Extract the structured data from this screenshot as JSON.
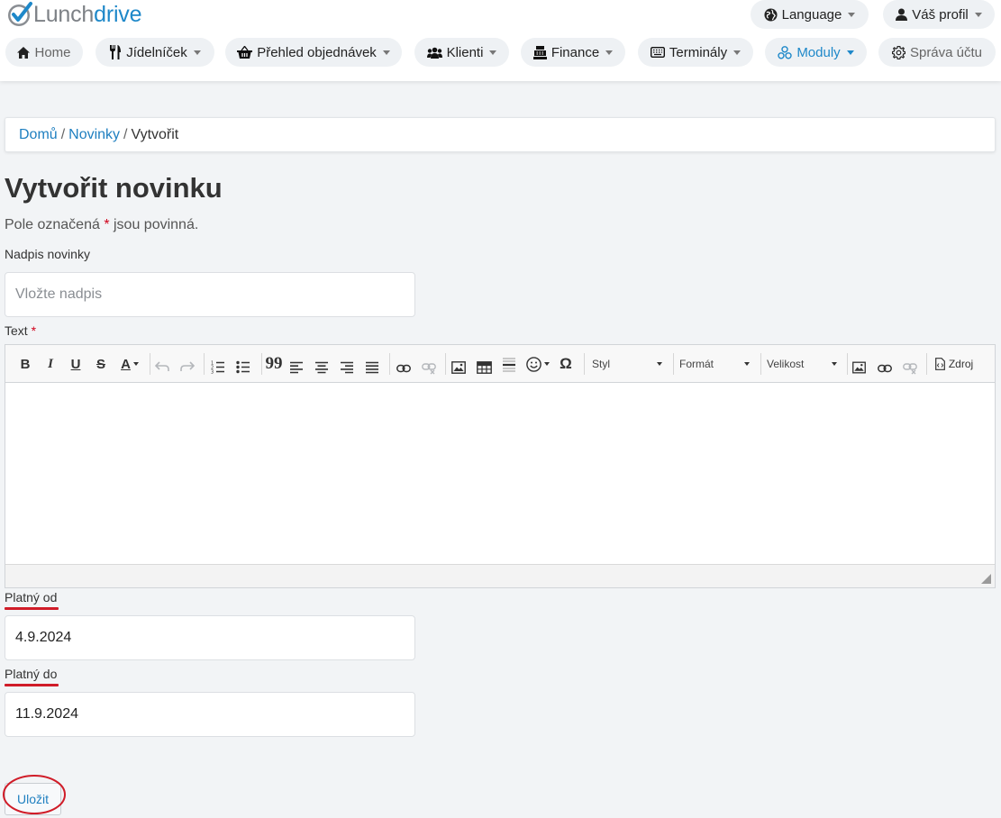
{
  "logo": {
    "part1": "Lunch",
    "part2": "drive"
  },
  "topnav": {
    "language": "Language",
    "profile": "Váš profil",
    "items": [
      {
        "label": "Home",
        "icon": "home-icon"
      },
      {
        "label": "Jídelníček",
        "icon": "cutlery-icon"
      },
      {
        "label": "Přehled objednávek",
        "icon": "basket-icon"
      },
      {
        "label": "Klienti",
        "icon": "users-icon"
      },
      {
        "label": "Finance",
        "icon": "cash-register-icon"
      },
      {
        "label": "Terminály",
        "icon": "keyboard-icon"
      },
      {
        "label": "Moduly",
        "icon": "cubes-icon",
        "active": true
      },
      {
        "label": "Správa účtu",
        "icon": "gear-icon"
      }
    ]
  },
  "breadcrumb": {
    "home": "Domů",
    "section": "Novinky",
    "current": "Vytvořit"
  },
  "page": {
    "title": "Vytvořit novinku",
    "required_note_before": "Pole označená",
    "required_star": "*",
    "required_note_after": "jsou povinná."
  },
  "form": {
    "headline": {
      "label": "Nadpis novinky",
      "placeholder": "Vložte nadpis",
      "value": ""
    },
    "text": {
      "label": "Text",
      "star": "*"
    },
    "valid_from": {
      "label": "Platný od",
      "value": "4.9.2024"
    },
    "valid_to": {
      "label": "Platný do",
      "value": "11.9.2024"
    },
    "save": "Uložit"
  },
  "editor_toolbar": {
    "bold": "B",
    "italic": "I",
    "underline": "U",
    "strike": "S",
    "color": "A",
    "blockquote": "99",
    "omega": "Ω",
    "style": "Styl",
    "format": "Formát",
    "size": "Velikost",
    "source": "Zdroj"
  },
  "colors": {
    "accent": "#1e88c9",
    "required": "#d0021b",
    "highlight": "#d01c28"
  }
}
